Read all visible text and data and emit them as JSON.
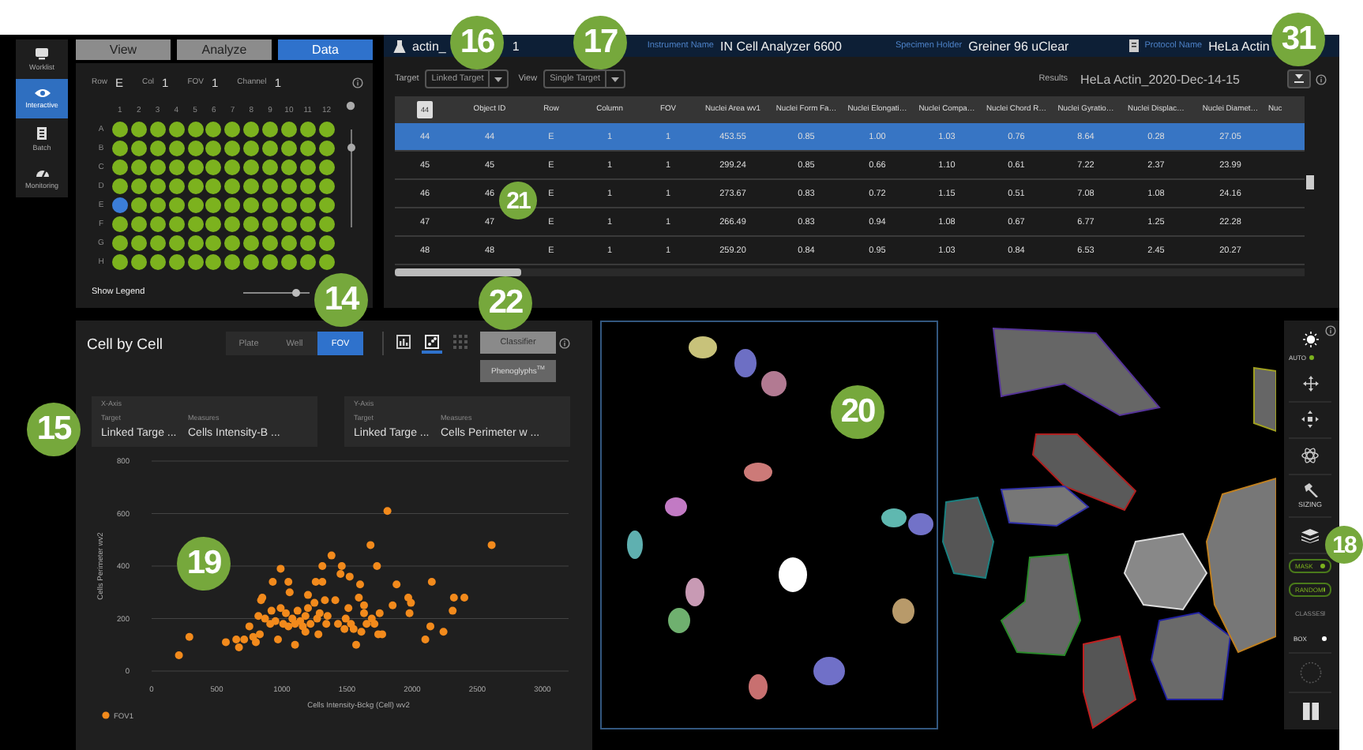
{
  "nav": [
    {
      "label": "Worklist",
      "selected": false
    },
    {
      "label": "Interactive",
      "selected": true
    },
    {
      "label": "Batch",
      "selected": false
    },
    {
      "label": "Monitoring",
      "selected": false
    }
  ],
  "mode_tabs": [
    {
      "label": "View",
      "selected": false
    },
    {
      "label": "Analyze",
      "selected": false
    },
    {
      "label": "Data",
      "selected": true
    }
  ],
  "plate": {
    "fields": [
      {
        "label": "Row",
        "value": "E"
      },
      {
        "label": "Col",
        "value": "1"
      },
      {
        "label": "FOV",
        "value": "1"
      },
      {
        "label": "Channel",
        "value": "1"
      }
    ],
    "columns": [
      "1",
      "2",
      "3",
      "4",
      "5",
      "6",
      "7",
      "8",
      "9",
      "10",
      "11",
      "12"
    ],
    "rows": [
      {
        "label": "A",
        "wells": [
          {
            "selected": false
          },
          {
            "selected": false
          },
          {
            "selected": false
          },
          {
            "selected": false
          },
          {
            "selected": false
          },
          {
            "selected": false
          },
          {
            "selected": false
          },
          {
            "selected": false
          },
          {
            "selected": false
          },
          {
            "selected": false
          },
          {
            "selected": false
          },
          {
            "selected": false
          }
        ]
      },
      {
        "label": "B",
        "wells": [
          {
            "selected": false
          },
          {
            "selected": false
          },
          {
            "selected": false
          },
          {
            "selected": false
          },
          {
            "selected": false
          },
          {
            "selected": false
          },
          {
            "selected": false
          },
          {
            "selected": false
          },
          {
            "selected": false
          },
          {
            "selected": false
          },
          {
            "selected": false
          },
          {
            "selected": false
          }
        ]
      },
      {
        "label": "C",
        "wells": [
          {
            "selected": false
          },
          {
            "selected": false
          },
          {
            "selected": false
          },
          {
            "selected": false
          },
          {
            "selected": false
          },
          {
            "selected": false
          },
          {
            "selected": false
          },
          {
            "selected": false
          },
          {
            "selected": false
          },
          {
            "selected": false
          },
          {
            "selected": false
          },
          {
            "selected": false
          }
        ]
      },
      {
        "label": "D",
        "wells": [
          {
            "selected": false
          },
          {
            "selected": false
          },
          {
            "selected": false
          },
          {
            "selected": false
          },
          {
            "selected": false
          },
          {
            "selected": false
          },
          {
            "selected": false
          },
          {
            "selected": false
          },
          {
            "selected": false
          },
          {
            "selected": false
          },
          {
            "selected": false
          },
          {
            "selected": false
          }
        ]
      },
      {
        "label": "E",
        "wells": [
          {
            "selected": true
          },
          {
            "selected": false
          },
          {
            "selected": false
          },
          {
            "selected": false
          },
          {
            "selected": false
          },
          {
            "selected": false
          },
          {
            "selected": false
          },
          {
            "selected": false
          },
          {
            "selected": false
          },
          {
            "selected": false
          },
          {
            "selected": false
          },
          {
            "selected": false
          }
        ]
      },
      {
        "label": "F",
        "wells": [
          {
            "selected": false
          },
          {
            "selected": false
          },
          {
            "selected": false
          },
          {
            "selected": false
          },
          {
            "selected": false
          },
          {
            "selected": false
          },
          {
            "selected": false
          },
          {
            "selected": false
          },
          {
            "selected": false
          },
          {
            "selected": false
          },
          {
            "selected": false
          },
          {
            "selected": false
          }
        ]
      },
      {
        "label": "G",
        "wells": [
          {
            "selected": false
          },
          {
            "selected": false
          },
          {
            "selected": false
          },
          {
            "selected": false
          },
          {
            "selected": false
          },
          {
            "selected": false
          },
          {
            "selected": false
          },
          {
            "selected": false
          },
          {
            "selected": false
          },
          {
            "selected": false
          },
          {
            "selected": false
          },
          {
            "selected": false
          }
        ]
      },
      {
        "label": "H",
        "wells": [
          {
            "selected": false
          },
          {
            "selected": false
          },
          {
            "selected": false
          },
          {
            "selected": false
          },
          {
            "selected": false
          },
          {
            "selected": false
          },
          {
            "selected": false
          },
          {
            "selected": false
          },
          {
            "selected": false
          },
          {
            "selected": false
          },
          {
            "selected": false
          },
          {
            "selected": false
          }
        ]
      }
    ],
    "zoom_slider": {
      "level": 0.85
    },
    "show_legend": "Show Legend",
    "size_slider": {
      "level": 0.85
    }
  },
  "results": {
    "header": {
      "name_start": "actin_",
      "name_end": "1",
      "instrument_label": "Instrument Name",
      "instrument": "IN Cell Analyzer 6600",
      "holder_label": "Specimen Holder",
      "holder": "Greiner 96 uClear",
      "protocol_label": "Protocol Name",
      "protocol": "HeLa Actin"
    },
    "target_label": "Target",
    "target": "Linked Target",
    "view_label": "View",
    "view": "Single Target",
    "results_label": "Results",
    "results_name": "HeLa Actin_2020-Dec-14-15",
    "table": {
      "columns": [
        "44",
        "Object ID",
        "Row",
        "Column",
        "FOV",
        "Nuclei Area wv1",
        "Nuclei Form Fa…",
        "Nuclei Elongati…",
        "Nuclei Compa…",
        "Nuclei Chord R…",
        "Nuclei Gyratio…",
        "Nuclei Displac…",
        "Nuclei Diamet…",
        "Nuc"
      ],
      "rows": [
        {
          "selected": true,
          "cells": [
            "44",
            "44",
            "E",
            "1",
            "1",
            "453.55",
            "0.85",
            "1.00",
            "1.03",
            "0.76",
            "8.64",
            "0.28",
            "27.05"
          ]
        },
        {
          "selected": false,
          "cells": [
            "45",
            "45",
            "E",
            "1",
            "1",
            "299.24",
            "0.85",
            "0.66",
            "1.10",
            "0.61",
            "7.22",
            "2.37",
            "23.99"
          ]
        },
        {
          "selected": false,
          "cells": [
            "46",
            "46",
            "E",
            "1",
            "1",
            "273.67",
            "0.83",
            "0.72",
            "1.15",
            "0.51",
            "7.08",
            "1.08",
            "24.16"
          ]
        },
        {
          "selected": false,
          "cells": [
            "47",
            "47",
            "E",
            "1",
            "1",
            "266.49",
            "0.83",
            "0.94",
            "1.08",
            "0.67",
            "6.77",
            "1.25",
            "22.28"
          ]
        },
        {
          "selected": false,
          "cells": [
            "48",
            "48",
            "E",
            "1",
            "1",
            "259.20",
            "0.84",
            "0.95",
            "1.03",
            "0.84",
            "6.53",
            "2.45",
            "20.27"
          ]
        }
      ]
    }
  },
  "chart_panel": {
    "title": "Cell by Cell",
    "levels": [
      {
        "label": "Plate",
        "selected": false
      },
      {
        "label": "Well",
        "selected": false
      },
      {
        "label": "FOV",
        "selected": true
      }
    ],
    "views": [
      {
        "selected": false
      },
      {
        "selected": true
      },
      {
        "selected": false
      }
    ],
    "classifier": "Classifier",
    "phenoglyphs": "Phenoglyphs$^{TM}$",
    "axes": [
      {
        "title": "X-Axis",
        "target_label": "Target",
        "measures_label": "Measures",
        "target": "Linked Targe ...",
        "measure": "Cells Intensity-B ..."
      },
      {
        "title": "Y-Axis",
        "target_label": "Target",
        "measures_label": "Measures",
        "target": "Linked Targe ...",
        "measure": "Cells Perimeter w ..."
      }
    ],
    "chart_data": {
      "type": "scatter",
      "xlabel": "Cells Intensity-Bckg (Cell) wv2",
      "ylabel": "Cells Perimeter wv2",
      "xlim": [
        0,
        3200
      ],
      "ylim": [
        0,
        800
      ],
      "grid": true,
      "xticks": [
        0,
        500,
        1000,
        1500,
        2000,
        2500,
        3000
      ],
      "yticks": [
        0,
        200,
        400,
        600,
        800
      ],
      "x": [
        210,
        290,
        570,
        650,
        670,
        710,
        750,
        780,
        800,
        820,
        830,
        840,
        850,
        870,
        910,
        920,
        930,
        950,
        970,
        990,
        990,
        1010,
        1030,
        1050,
        1050,
        1060,
        1080,
        1100,
        1100,
        1120,
        1140,
        1160,
        1180,
        1180,
        1200,
        1200,
        1220,
        1250,
        1260,
        1270,
        1280,
        1290,
        1310,
        1310,
        1330,
        1340,
        1350,
        1380,
        1410,
        1430,
        1450,
        1460,
        1480,
        1490,
        1510,
        1520,
        1530,
        1550,
        1570,
        1590,
        1600,
        1610,
        1630,
        1650,
        1680,
        1690,
        1710,
        1730,
        1740,
        1750,
        1770,
        1810,
        1850,
        1880,
        1970,
        1980,
        1990,
        2100,
        2140,
        2150,
        2240,
        2310,
        2320,
        2400,
        2610,
        1630
      ],
      "series": [
        {
          "name": "FOV1",
          "color": "#f28a1c",
          "values": [
            60,
            130,
            110,
            120,
            90,
            120,
            170,
            130,
            110,
            210,
            140,
            270,
            280,
            200,
            180,
            230,
            340,
            190,
            120,
            390,
            240,
            180,
            220,
            170,
            340,
            300,
            200,
            100,
            180,
            230,
            190,
            170,
            150,
            210,
            290,
            240,
            180,
            260,
            340,
            200,
            140,
            220,
            340,
            400,
            270,
            180,
            210,
            440,
            270,
            180,
            370,
            400,
            160,
            200,
            240,
            360,
            180,
            160,
            100,
            280,
            330,
            150,
            220,
            180,
            480,
            200,
            180,
            400,
            140,
            220,
            140,
            610,
            250,
            330,
            280,
            220,
            260,
            120,
            170,
            340,
            150,
            230,
            280,
            280,
            480,
            250
          ]
        }
      ]
    }
  },
  "image_view": {
    "panes": [
      {
        "kind": "picture",
        "selected": true
      },
      {
        "kind": "picture",
        "selected": false
      }
    ]
  },
  "image_toolbar": {
    "auto": {
      "label": "AUTO",
      "on": true
    },
    "sizing": "SIZING",
    "toggles": [
      {
        "kind": "pill",
        "label": "MASK",
        "on": true,
        "disabled": false
      },
      {
        "kind": "pill",
        "label": "RANDOM",
        "on": true,
        "disabled": false
      },
      {
        "kind": "pill",
        "label": "CLASSES",
        "on": false,
        "disabled": true
      },
      {
        "kind": "plain",
        "label": "BOX",
        "on": true,
        "disabled": false
      }
    ]
  },
  "callouts": [
    "14",
    "15",
    "16",
    "17",
    "18",
    "19",
    "20",
    "21",
    "22",
    "31"
  ]
}
